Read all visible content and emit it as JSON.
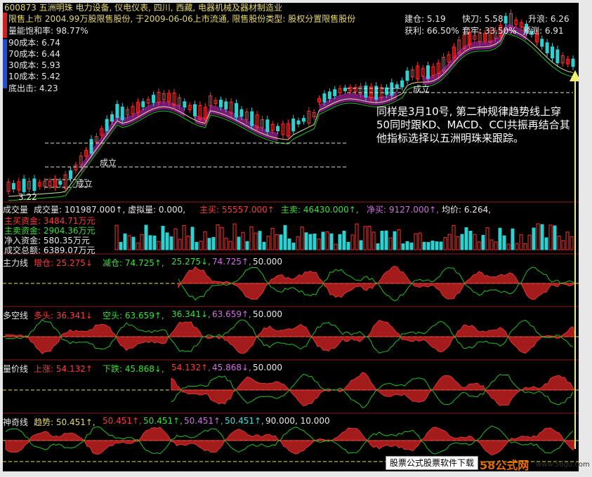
{
  "header": {
    "stock": "600873 五洲明珠 电力设备, 仪电仪表, 四川, 西藏, 电器机械及器材制造业",
    "restricted": "限售上市  2004.99万股限售股份, 于2009-06-06上市流通, 限售股份类型: 股权分置限售股份",
    "saturation": "量能饱和率: 98.77%",
    "cost90": "90成本: 6.74",
    "cost70": "70成本: 6.44",
    "cost30": "30成本: 5.93",
    "cost10": "10成本: 5.42",
    "bottom": "底出击: 4.23"
  },
  "right_info": {
    "jiancang": "建仓: 5.19",
    "kuaidao": "快刀: 5.58",
    "shenglang": "升浪: 6.26",
    "huoli": "获利: 66.50%",
    "taolao": "套牢: 33.50%",
    "yuce": "预测: 6.91"
  },
  "chart_labels": {
    "chengli1": "成立",
    "chengli2": "成立",
    "chengli3": "成立",
    "low": "3.22"
  },
  "volume_panel": {
    "title": "成交量",
    "line": "成交量: 101987.000↑, 虚拟量: 0.000,",
    "zhumai": "主买: 55557.000↑",
    "zhumai2": "主卖: 46430.000↑,",
    "jingmai": "净买: 9127.000↑,",
    "avg": "均价: 6.264,",
    "zhumaizj": "主买资金: 3484.71万元",
    "zhumaiz2": "主卖资金: 2904.36万元",
    "jingru": "净入资金: 580.35万元",
    "total": "成交总额: 6389.07万元"
  },
  "panel1": {
    "name": "主力线",
    "a": "增仓: 25.275↓",
    "b": "减仓: 74.725↑,",
    "c": "25.275↓,",
    "d": "74.725↑,",
    "e": "50.000"
  },
  "panel2": {
    "name": "多空线",
    "a": "多头: 36.341↓",
    "b": "空头: 63.659↑,",
    "c": "36.341↓,",
    "d": "63.659↑,",
    "e": "50.000"
  },
  "panel3": {
    "name": "量价线",
    "a": "上涨: 54.132↑",
    "b": "下跌: 45.868↓,",
    "c": "54.132↑,",
    "d": "45.868↓,",
    "e": "50.000"
  },
  "panel4": {
    "name": "神奇线",
    "a": "趋势: 50.451↑,",
    "b": "50.451↑,",
    "c": "50.451↑,",
    "d": "50.451↑,",
    "e": "50.451↑,",
    "f": "90.000, 10.000"
  },
  "annotation": "同样是3月10号, 第二种规律趋势线上穿50同时跟KD、MACD、CCI共振再结合其他指标选择以五洲明珠来跟踪。",
  "footer": {
    "label": "股票公式股票软件下载",
    "watermark": "58公式网",
    "url": "www.58gu.com"
  },
  "colors": {
    "up": "#ff3030",
    "down": "#30d0d0",
    "ribbon": "#7a1a7a",
    "panel_fill": "#c02020",
    "green_line": "#20c020",
    "dash": "#e8e040"
  }
}
